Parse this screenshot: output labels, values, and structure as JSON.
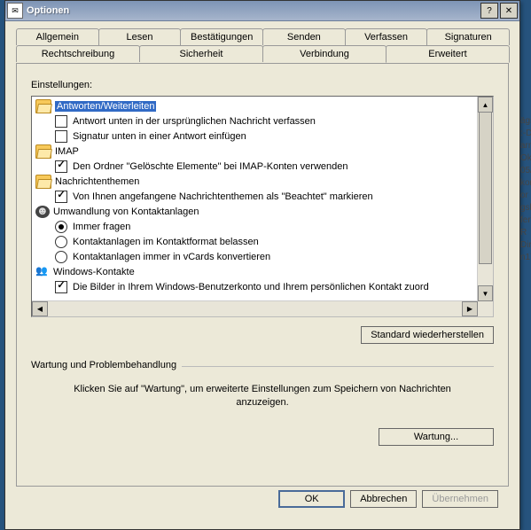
{
  "window": {
    "title": "Optionen"
  },
  "tabs": {
    "row1": [
      "Allgemein",
      "Lesen",
      "Bestätigungen",
      "Senden",
      "Verfassen",
      "Signaturen"
    ],
    "row2": [
      "Rechtschreibung",
      "Sicherheit",
      "Verbindung",
      "Erweitert"
    ],
    "active": "Erweitert"
  },
  "settings_label": "Einstellungen:",
  "tree": {
    "g0": {
      "label": "Antworten/Weiterleiten",
      "selected": true,
      "items": [
        {
          "label": "Antwort unten in der ursprünglichen Nachricht verfassen",
          "checked": false
        },
        {
          "label": "Signatur unten in einer Antwort einfügen",
          "checked": false
        }
      ]
    },
    "g1": {
      "label": "IMAP",
      "items": [
        {
          "label": "Den Ordner \"Gelöschte Elemente\" bei IMAP-Konten verwenden",
          "checked": true
        }
      ]
    },
    "g2": {
      "label": "Nachrichtenthemen",
      "items": [
        {
          "label": "Von Ihnen angefangene Nachrichtenthemen als \"Beachtet\" markieren",
          "checked": true
        }
      ]
    },
    "g3": {
      "label": "Umwandlung von Kontaktanlagen",
      "type": "radio",
      "items": [
        {
          "label": "Immer fragen",
          "checked": true
        },
        {
          "label": "Kontaktanlagen im Kontaktformat belassen",
          "checked": false
        },
        {
          "label": "Kontaktanlagen immer in vCards konvertieren",
          "checked": false
        }
      ]
    },
    "g4": {
      "label": "Windows-Kontakte",
      "items": [
        {
          "label": "Die Bilder in Ihrem Windows-Benutzerkonto und Ihrem persönlichen Kontakt zuord",
          "checked": true
        }
      ]
    }
  },
  "buttons": {
    "restore": "Standard wiederherstellen",
    "maint": "Wartung...",
    "ok": "OK",
    "cancel": "Abbrechen",
    "apply": "Übernehmen"
  },
  "maint_group": "Wartung und Problembehandlung",
  "maint_text": "Klicken Sie auf \"Wartung\", um erweiterte Einstellungen zum Speichern von Nachrichten anzuzeigen.",
  "behind_text": "ägs\n:-D\narm\nOkt\n05/\nkon\nor\n\ngsb\nfer\ng R\nDir\n\nn17"
}
